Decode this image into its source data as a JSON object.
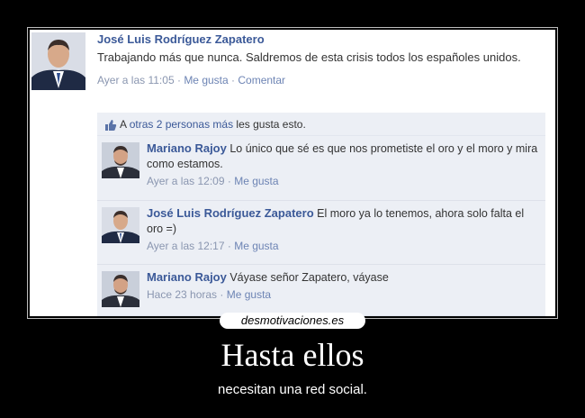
{
  "post": {
    "author": "José Luis Rodríguez Zapatero",
    "text": "Trabajando más que nunca. Saldremos de esta crisis todos los españoles unidos.",
    "time": "Ayer a las 11:05",
    "like": "Me gusta",
    "comment": "Comentar"
  },
  "likes": {
    "prefix": "A",
    "link": "otras 2 personas más",
    "suffix": "les gusta esto."
  },
  "comments": [
    {
      "author": "Mariano Rajoy",
      "text": "Lo único que sé es que nos prometiste el oro y el moro y mira como estamos.",
      "time": "Ayer a las 12:09",
      "like": "Me gusta"
    },
    {
      "author": "José Luis Rodríguez Zapatero",
      "text": "El moro ya lo tenemos, ahora solo falta el oro =)",
      "time": "Ayer a las 12:17",
      "like": "Me gusta"
    },
    {
      "author": "Mariano Rajoy",
      "text": "Váyase señor Zapatero, váyase",
      "time": "Hace 23 horas",
      "like": "Me gusta"
    }
  ],
  "separator": "·",
  "logo": "desmotivaciones.es",
  "title": "Hasta ellos",
  "subtitle": "necesitan una red social."
}
